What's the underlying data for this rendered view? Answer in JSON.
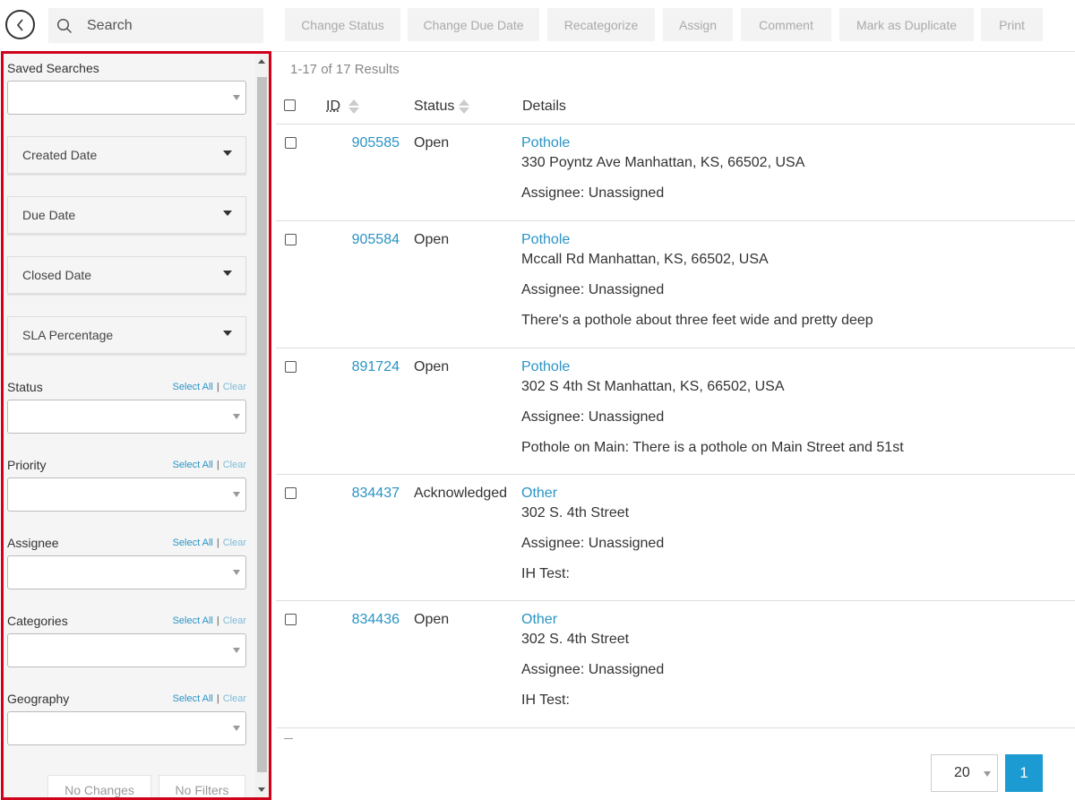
{
  "toolbar": {
    "search_placeholder": "Search",
    "buttons": [
      "Change Status",
      "Change Due Date",
      "Recategorize",
      "Assign",
      "Comment",
      "Mark as Duplicate",
      "Print"
    ]
  },
  "sidebar": {
    "saved_searches_label": "Saved Searches",
    "date_filters": [
      "Created Date",
      "Due Date",
      "Closed Date",
      "SLA Percentage"
    ],
    "select_all": "Select All",
    "separator": "|",
    "clear": "Clear",
    "multi_filters": [
      "Status",
      "Priority",
      "Assignee",
      "Categories",
      "Geography"
    ],
    "no_changes": "No Changes",
    "no_filters": "No Filters"
  },
  "main": {
    "results_count": "1-17 of 17 Results",
    "columns": {
      "id": "ID",
      "status": "Status",
      "details": "Details"
    },
    "rows": [
      {
        "id": "905585",
        "status": "Open",
        "category": "Pothole",
        "address": "330 Poyntz Ave Manhattan, KS, 66502, USA",
        "assignee": "Assignee: Unassigned",
        "description": ""
      },
      {
        "id": "905584",
        "status": "Open",
        "category": "Pothole",
        "address": "Mccall Rd Manhattan, KS, 66502, USA",
        "assignee": "Assignee: Unassigned",
        "description": "There's a pothole about three feet wide and pretty deep"
      },
      {
        "id": "891724",
        "status": "Open",
        "category": "Pothole",
        "address": "302 S 4th St Manhattan, KS, 66502, USA",
        "assignee": "Assignee: Unassigned",
        "description": "Pothole on Main: There is a pothole on Main Street and 51st"
      },
      {
        "id": "834437",
        "status": "Acknowledged",
        "category": "Other",
        "address": "302 S. 4th Street",
        "assignee": "Assignee: Unassigned",
        "description": "IH Test:"
      },
      {
        "id": "834436",
        "status": "Open",
        "category": "Other",
        "address": "302 S. 4th Street",
        "assignee": "Assignee: Unassigned",
        "description": "IH Test:"
      }
    ],
    "page_size": "20",
    "current_page": "1"
  },
  "colors": {
    "accent": "#2a94c4",
    "highlight_border": "#d0021b",
    "page_button": "#1b9bd1"
  }
}
